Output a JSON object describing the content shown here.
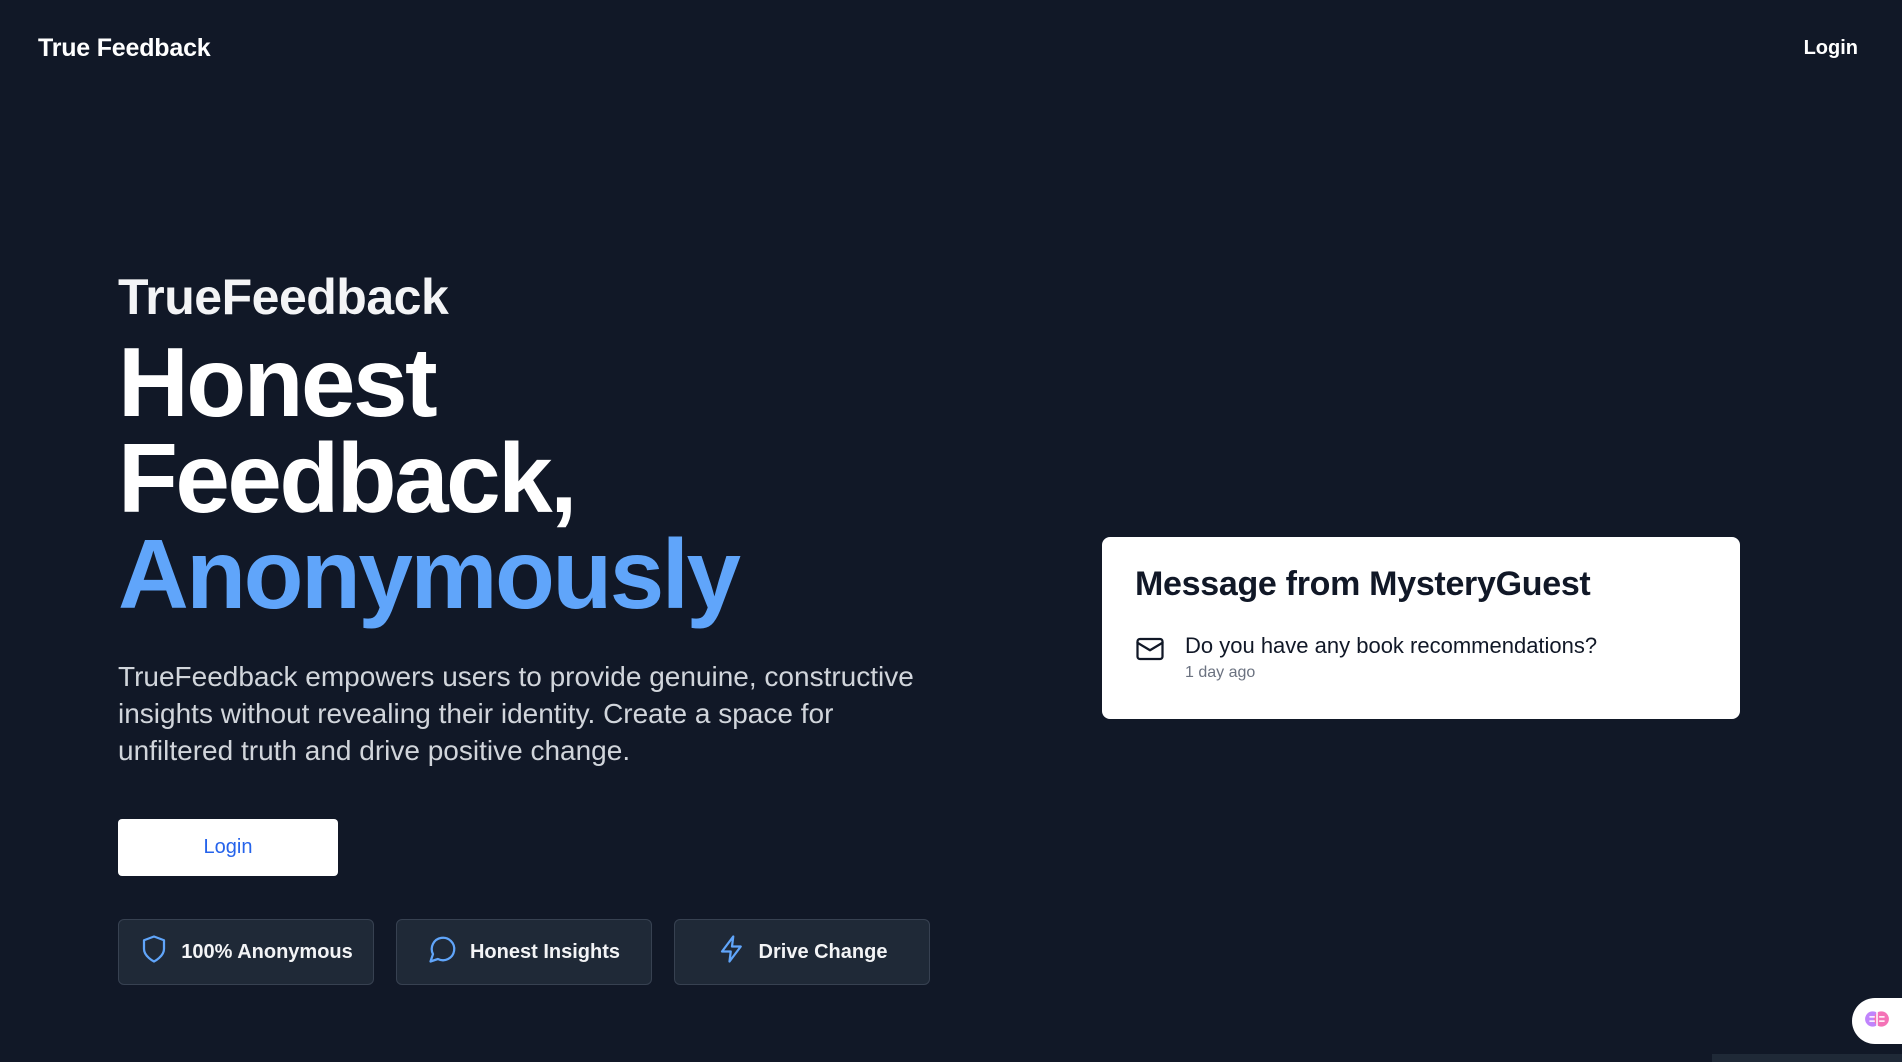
{
  "nav": {
    "brand": "True Feedback",
    "login_label": "Login"
  },
  "hero": {
    "eyebrow": "TrueFeedback",
    "headline_line1": "Honest",
    "headline_line2": "Feedback,",
    "headline_accent": "Anonymously",
    "description": "TrueFeedback empowers users to provide genuine, constructive insights without revealing their identity. Create a space for unfiltered truth and drive positive change.",
    "cta_label": "Login"
  },
  "features": [
    {
      "label": "100% Anonymous",
      "icon": "shield-icon"
    },
    {
      "label": "Honest Insights",
      "icon": "chat-bubble-icon"
    },
    {
      "label": "Drive Change",
      "icon": "lightning-icon"
    }
  ],
  "message_card": {
    "title": "Message from MysteryGuest",
    "body": "Do you have any book recommendations?",
    "time": "1 day ago",
    "icon": "mail-icon"
  },
  "assistant": {
    "icon": "brain-icon"
  },
  "colors": {
    "background": "#111827",
    "accent": "#60a5fa",
    "button_text": "#2563eb",
    "card": "#ffffff"
  }
}
